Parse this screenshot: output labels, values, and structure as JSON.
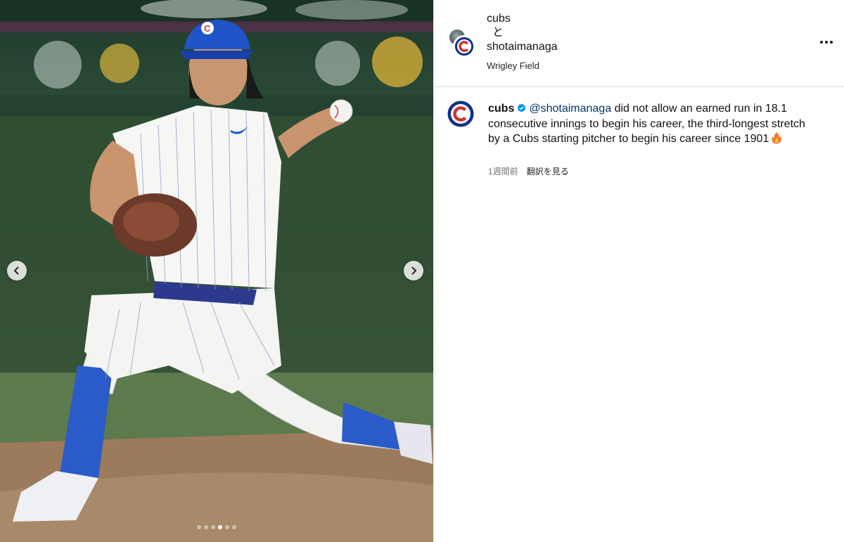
{
  "post": {
    "authors": {
      "first": "cubs",
      "joiner": "と",
      "second": "shotaimanaga"
    },
    "location": "Wrigley Field",
    "more_icon": "more-horizontal-icon"
  },
  "caption": {
    "username": "cubs",
    "mention": "@shotaimanaga",
    "text": "did not allow an earned run in 18.1 consecutive innings to begin his career, the third-longest stretch by a Cubs starting pitcher to begin his career since 1901",
    "emoji_icon": "fire-icon",
    "time": "1週間前",
    "translate_label": "翻訳を見る"
  },
  "carousel": {
    "total": 6,
    "active_index": 3
  },
  "colors": {
    "cubs_blue": "#0e3386",
    "cubs_red": "#cc3433",
    "verified_blue": "#0095f6",
    "link": "#00376b"
  }
}
